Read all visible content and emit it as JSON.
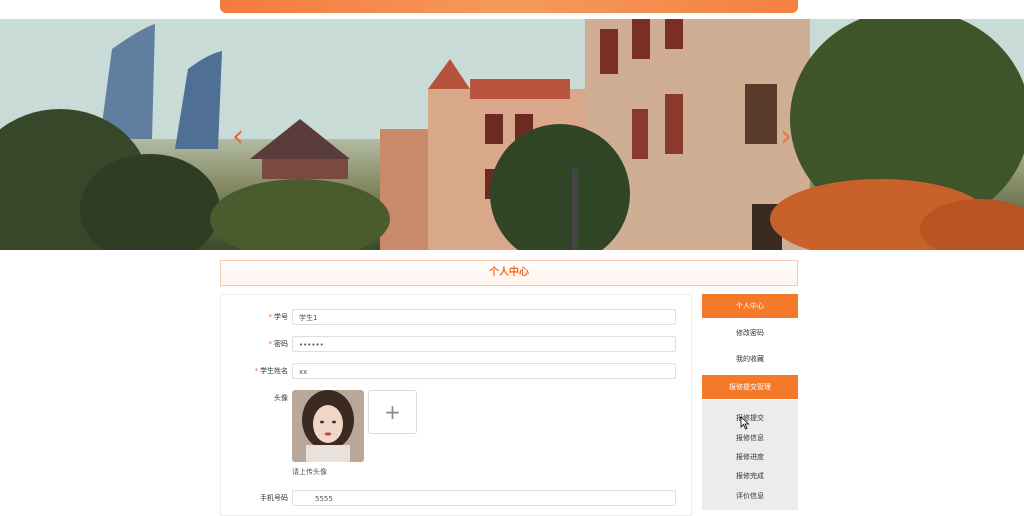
{
  "profile": {
    "title": "个人中心",
    "fields": [
      {
        "label": "学号",
        "required": true,
        "value": "学生1"
      },
      {
        "label": "密码",
        "required": true,
        "value": "••••••"
      },
      {
        "label": "学生姓名",
        "required": true,
        "value": "xx"
      }
    ],
    "avatar_label": "头像",
    "upload_hint": "请上传头像",
    "upload_icon": "+",
    "phone_label": "手机号码",
    "phone_value": "5555"
  },
  "sidebar": {
    "items": [
      {
        "label": "个人中心",
        "active": true
      },
      {
        "label": "修改密码",
        "active": false
      },
      {
        "label": "我的收藏",
        "active": false
      },
      {
        "label": "报修提交管理",
        "active": true
      }
    ],
    "sub_items": [
      "报修提交",
      "报修信息",
      "报修进度",
      "报修完成",
      "评价信息"
    ]
  },
  "carousel": {
    "prev_icon": "‹",
    "next_icon": "›"
  },
  "icons": {
    "required_mark": "*"
  },
  "colors": {
    "accent": "#f47a2a",
    "title_text": "#f26b1d"
  }
}
